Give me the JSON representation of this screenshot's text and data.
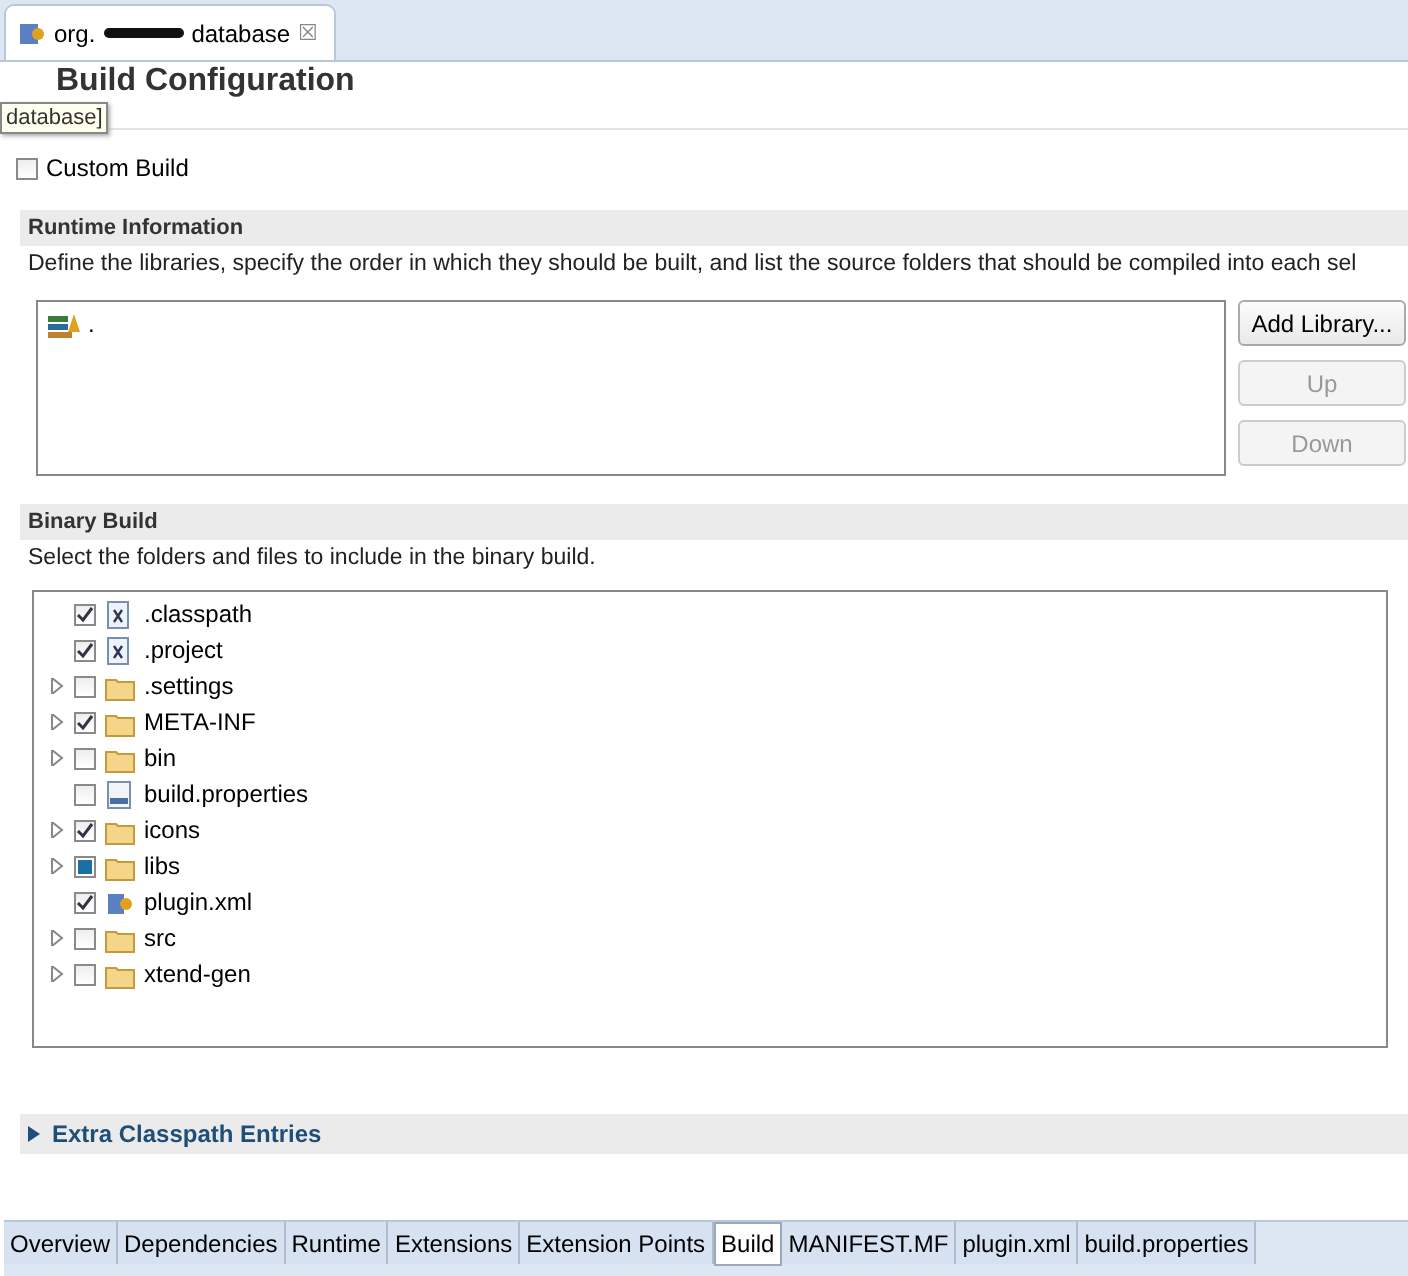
{
  "editor_tab": {
    "prefix": "org.",
    "suffix": "database",
    "close": "☒"
  },
  "tooltip": "database]",
  "title": "Build Configuration",
  "custom_build": {
    "label": "Custom Build",
    "checked": false
  },
  "runtime": {
    "heading": "Runtime Information",
    "description": "Define the libraries, specify the order in which they should be built, and list the source folders that should be compiled into each sel",
    "libraries": [
      {
        "name": "."
      }
    ],
    "buttons": [
      {
        "label": "Add Library...",
        "disabled": false
      },
      {
        "label": "Up",
        "disabled": true
      },
      {
        "label": "Down",
        "disabled": true
      }
    ]
  },
  "binary": {
    "heading": "Binary Build",
    "description": "Select the folders and files to include in the binary build.",
    "items": [
      {
        "name": ".classpath",
        "kind": "xml",
        "expandable": false,
        "checked": true,
        "grayed": false
      },
      {
        "name": ".project",
        "kind": "xml",
        "expandable": false,
        "checked": true,
        "grayed": false
      },
      {
        "name": ".settings",
        "kind": "folder",
        "expandable": true,
        "checked": false,
        "grayed": false
      },
      {
        "name": "META-INF",
        "kind": "folder",
        "expandable": true,
        "checked": true,
        "grayed": false
      },
      {
        "name": "bin",
        "kind": "folder",
        "expandable": true,
        "checked": false,
        "grayed": false
      },
      {
        "name": "build.properties",
        "kind": "binary",
        "expandable": false,
        "checked": false,
        "grayed": false
      },
      {
        "name": "icons",
        "kind": "folder",
        "expandable": true,
        "checked": true,
        "grayed": false
      },
      {
        "name": "libs",
        "kind": "folder",
        "expandable": true,
        "checked": false,
        "grayed": true
      },
      {
        "name": "plugin.xml",
        "kind": "plugin",
        "expandable": false,
        "checked": true,
        "grayed": false
      },
      {
        "name": "src",
        "kind": "folder",
        "expandable": true,
        "checked": false,
        "grayed": false
      },
      {
        "name": "xtend-gen",
        "kind": "folder",
        "expandable": true,
        "checked": false,
        "grayed": false
      }
    ]
  },
  "extra": {
    "heading": "Extra Classpath Entries",
    "expanded": false
  },
  "page_tabs": [
    {
      "label": "Overview",
      "selected": false
    },
    {
      "label": "Dependencies",
      "selected": false
    },
    {
      "label": "Runtime",
      "selected": false
    },
    {
      "label": "Extensions",
      "selected": false
    },
    {
      "label": "Extension Points",
      "selected": false
    },
    {
      "label": "Build",
      "selected": true
    },
    {
      "label": "MANIFEST.MF",
      "selected": false
    },
    {
      "label": "plugin.xml",
      "selected": false
    },
    {
      "label": "build.properties",
      "selected": false
    }
  ]
}
